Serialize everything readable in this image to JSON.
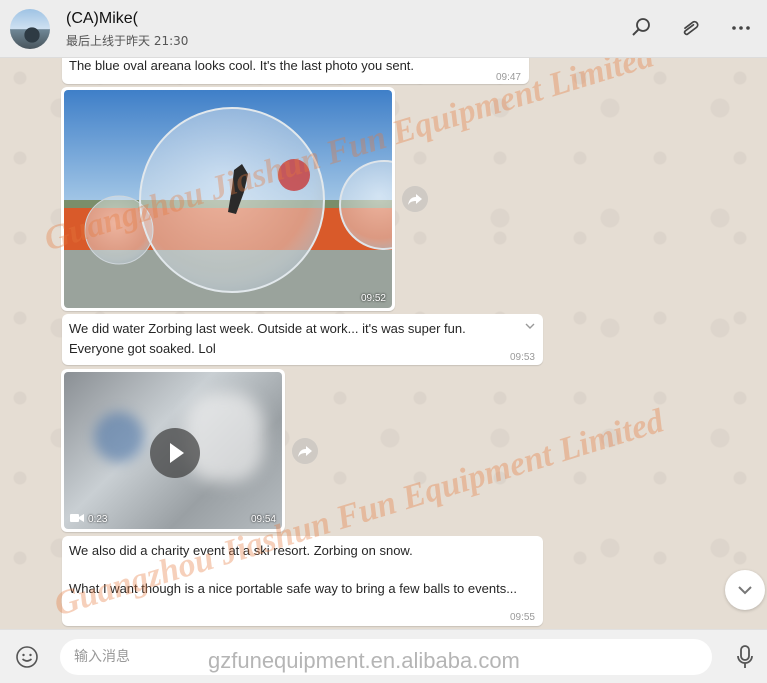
{
  "header": {
    "contact_name": "(CA)Mike(",
    "last_seen": "最后上线于昨天 21:30"
  },
  "messages": [
    {
      "text": "The blue oval areana looks cool. It's the last photo you sent.",
      "time": "09:47"
    },
    {
      "type": "image",
      "time": "09:52"
    },
    {
      "text": "We did water Zorbing last week. Outside at work... it's was super fun. Everyone got soaked. Lol",
      "time": "09:53"
    },
    {
      "type": "video",
      "duration": "0:23",
      "time": "09:54"
    },
    {
      "text_line1": "We also did a charity event at a ski resort. Zorbing on snow.",
      "text_line2": "What I want though is a nice portable safe way to bring a few balls to events...",
      "time": "09:55"
    }
  ],
  "watermarks": {
    "company_1": "Guangzhou Jiashun Fun Equipment Limited",
    "company_2": "Guangzhou Jiashun Fun Equipment Limited",
    "site": "gzfunequipment.en.alibaba.com"
  },
  "composer": {
    "placeholder": "输入消息"
  },
  "icons": {
    "search": "search-icon",
    "attach": "paperclip-icon",
    "menu": "more-icon",
    "emoji": "emoji-icon",
    "mic": "microphone-icon",
    "forward": "forward-icon",
    "scroll": "chevron-down-icon"
  },
  "colors": {
    "bubble": "#ffffff",
    "chat_bg": "#e5ddd3",
    "header_bg": "#ededed",
    "watermark": "#e6783c"
  }
}
